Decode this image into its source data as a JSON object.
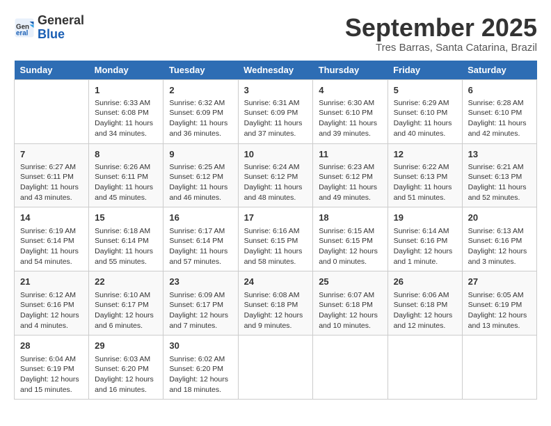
{
  "logo": {
    "general": "General",
    "blue": "Blue"
  },
  "title": "September 2025",
  "location": "Tres Barras, Santa Catarina, Brazil",
  "headers": [
    "Sunday",
    "Monday",
    "Tuesday",
    "Wednesday",
    "Thursday",
    "Friday",
    "Saturday"
  ],
  "weeks": [
    [
      {
        "day": "",
        "sunrise": "",
        "sunset": "",
        "daylight": ""
      },
      {
        "day": "1",
        "sunrise": "Sunrise: 6:33 AM",
        "sunset": "Sunset: 6:08 PM",
        "daylight": "Daylight: 11 hours and 34 minutes."
      },
      {
        "day": "2",
        "sunrise": "Sunrise: 6:32 AM",
        "sunset": "Sunset: 6:09 PM",
        "daylight": "Daylight: 11 hours and 36 minutes."
      },
      {
        "day": "3",
        "sunrise": "Sunrise: 6:31 AM",
        "sunset": "Sunset: 6:09 PM",
        "daylight": "Daylight: 11 hours and 37 minutes."
      },
      {
        "day": "4",
        "sunrise": "Sunrise: 6:30 AM",
        "sunset": "Sunset: 6:10 PM",
        "daylight": "Daylight: 11 hours and 39 minutes."
      },
      {
        "day": "5",
        "sunrise": "Sunrise: 6:29 AM",
        "sunset": "Sunset: 6:10 PM",
        "daylight": "Daylight: 11 hours and 40 minutes."
      },
      {
        "day": "6",
        "sunrise": "Sunrise: 6:28 AM",
        "sunset": "Sunset: 6:10 PM",
        "daylight": "Daylight: 11 hours and 42 minutes."
      }
    ],
    [
      {
        "day": "7",
        "sunrise": "Sunrise: 6:27 AM",
        "sunset": "Sunset: 6:11 PM",
        "daylight": "Daylight: 11 hours and 43 minutes."
      },
      {
        "day": "8",
        "sunrise": "Sunrise: 6:26 AM",
        "sunset": "Sunset: 6:11 PM",
        "daylight": "Daylight: 11 hours and 45 minutes."
      },
      {
        "day": "9",
        "sunrise": "Sunrise: 6:25 AM",
        "sunset": "Sunset: 6:12 PM",
        "daylight": "Daylight: 11 hours and 46 minutes."
      },
      {
        "day": "10",
        "sunrise": "Sunrise: 6:24 AM",
        "sunset": "Sunset: 6:12 PM",
        "daylight": "Daylight: 11 hours and 48 minutes."
      },
      {
        "day": "11",
        "sunrise": "Sunrise: 6:23 AM",
        "sunset": "Sunset: 6:12 PM",
        "daylight": "Daylight: 11 hours and 49 minutes."
      },
      {
        "day": "12",
        "sunrise": "Sunrise: 6:22 AM",
        "sunset": "Sunset: 6:13 PM",
        "daylight": "Daylight: 11 hours and 51 minutes."
      },
      {
        "day": "13",
        "sunrise": "Sunrise: 6:21 AM",
        "sunset": "Sunset: 6:13 PM",
        "daylight": "Daylight: 11 hours and 52 minutes."
      }
    ],
    [
      {
        "day": "14",
        "sunrise": "Sunrise: 6:19 AM",
        "sunset": "Sunset: 6:14 PM",
        "daylight": "Daylight: 11 hours and 54 minutes."
      },
      {
        "day": "15",
        "sunrise": "Sunrise: 6:18 AM",
        "sunset": "Sunset: 6:14 PM",
        "daylight": "Daylight: 11 hours and 55 minutes."
      },
      {
        "day": "16",
        "sunrise": "Sunrise: 6:17 AM",
        "sunset": "Sunset: 6:14 PM",
        "daylight": "Daylight: 11 hours and 57 minutes."
      },
      {
        "day": "17",
        "sunrise": "Sunrise: 6:16 AM",
        "sunset": "Sunset: 6:15 PM",
        "daylight": "Daylight: 11 hours and 58 minutes."
      },
      {
        "day": "18",
        "sunrise": "Sunrise: 6:15 AM",
        "sunset": "Sunset: 6:15 PM",
        "daylight": "Daylight: 12 hours and 0 minutes."
      },
      {
        "day": "19",
        "sunrise": "Sunrise: 6:14 AM",
        "sunset": "Sunset: 6:16 PM",
        "daylight": "Daylight: 12 hours and 1 minute."
      },
      {
        "day": "20",
        "sunrise": "Sunrise: 6:13 AM",
        "sunset": "Sunset: 6:16 PM",
        "daylight": "Daylight: 12 hours and 3 minutes."
      }
    ],
    [
      {
        "day": "21",
        "sunrise": "Sunrise: 6:12 AM",
        "sunset": "Sunset: 6:16 PM",
        "daylight": "Daylight: 12 hours and 4 minutes."
      },
      {
        "day": "22",
        "sunrise": "Sunrise: 6:10 AM",
        "sunset": "Sunset: 6:17 PM",
        "daylight": "Daylight: 12 hours and 6 minutes."
      },
      {
        "day": "23",
        "sunrise": "Sunrise: 6:09 AM",
        "sunset": "Sunset: 6:17 PM",
        "daylight": "Daylight: 12 hours and 7 minutes."
      },
      {
        "day": "24",
        "sunrise": "Sunrise: 6:08 AM",
        "sunset": "Sunset: 6:18 PM",
        "daylight": "Daylight: 12 hours and 9 minutes."
      },
      {
        "day": "25",
        "sunrise": "Sunrise: 6:07 AM",
        "sunset": "Sunset: 6:18 PM",
        "daylight": "Daylight: 12 hours and 10 minutes."
      },
      {
        "day": "26",
        "sunrise": "Sunrise: 6:06 AM",
        "sunset": "Sunset: 6:18 PM",
        "daylight": "Daylight: 12 hours and 12 minutes."
      },
      {
        "day": "27",
        "sunrise": "Sunrise: 6:05 AM",
        "sunset": "Sunset: 6:19 PM",
        "daylight": "Daylight: 12 hours and 13 minutes."
      }
    ],
    [
      {
        "day": "28",
        "sunrise": "Sunrise: 6:04 AM",
        "sunset": "Sunset: 6:19 PM",
        "daylight": "Daylight: 12 hours and 15 minutes."
      },
      {
        "day": "29",
        "sunrise": "Sunrise: 6:03 AM",
        "sunset": "Sunset: 6:20 PM",
        "daylight": "Daylight: 12 hours and 16 minutes."
      },
      {
        "day": "30",
        "sunrise": "Sunrise: 6:02 AM",
        "sunset": "Sunset: 6:20 PM",
        "daylight": "Daylight: 12 hours and 18 minutes."
      },
      {
        "day": "",
        "sunrise": "",
        "sunset": "",
        "daylight": ""
      },
      {
        "day": "",
        "sunrise": "",
        "sunset": "",
        "daylight": ""
      },
      {
        "day": "",
        "sunrise": "",
        "sunset": "",
        "daylight": ""
      },
      {
        "day": "",
        "sunrise": "",
        "sunset": "",
        "daylight": ""
      }
    ]
  ]
}
